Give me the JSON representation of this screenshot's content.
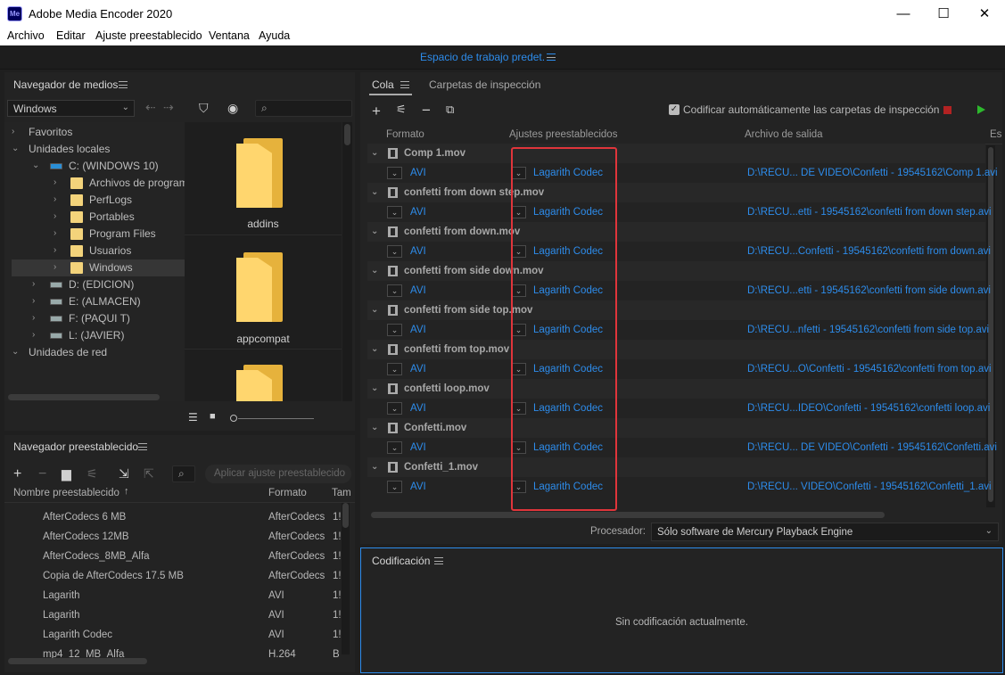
{
  "app": {
    "title": "Adobe Media Encoder 2020",
    "icon_text": "Me"
  },
  "window_controls": {
    "minimize": "—",
    "maximize": "☐",
    "close": "✕"
  },
  "menu": [
    "Archivo",
    "Editar",
    "Ajuste preestablecido",
    "Ventana",
    "Ayuda"
  ],
  "workspace": {
    "label": "Espacio de trabajo predet."
  },
  "media_browser": {
    "title": "Navegador de medios",
    "location": "Windows",
    "tree": [
      {
        "label": "Favoritos",
        "level": 0,
        "expanded": false,
        "kind": "section"
      },
      {
        "label": "Unidades locales",
        "level": 0,
        "expanded": true,
        "kind": "section"
      },
      {
        "label": "C: (WINDOWS 10)",
        "level": 1,
        "expanded": true,
        "kind": "drive"
      },
      {
        "label": "Archivos de programa",
        "level": 2,
        "expanded": false,
        "kind": "folder"
      },
      {
        "label": "PerfLogs",
        "level": 2,
        "expanded": false,
        "kind": "folder"
      },
      {
        "label": "Portables",
        "level": 2,
        "expanded": false,
        "kind": "folder"
      },
      {
        "label": "Program Files",
        "level": 2,
        "expanded": false,
        "kind": "folder"
      },
      {
        "label": "Usuarios",
        "level": 2,
        "expanded": false,
        "kind": "folder"
      },
      {
        "label": "Windows",
        "level": 2,
        "expanded": false,
        "kind": "folder",
        "selected": true
      },
      {
        "label": "D: (EDICION)",
        "level": 1,
        "expanded": false,
        "kind": "drive"
      },
      {
        "label": "E: (ALMACEN)",
        "level": 1,
        "expanded": false,
        "kind": "drive"
      },
      {
        "label": "F: (PAQUI T)",
        "level": 1,
        "expanded": false,
        "kind": "drive"
      },
      {
        "label": "L: (JAVIER)",
        "level": 1,
        "expanded": false,
        "kind": "drive"
      },
      {
        "label": "Unidades de red",
        "level": 0,
        "expanded": true,
        "kind": "section"
      }
    ],
    "thumbnails": [
      {
        "label": "addins"
      },
      {
        "label": "appcompat"
      },
      {
        "label": ""
      }
    ]
  },
  "preset_browser": {
    "title": "Navegador preestablecido",
    "apply_placeholder": "Aplicar ajuste preestablecido",
    "columns": [
      "Nombre preestablecido",
      "Formato",
      "Tam"
    ],
    "rows": [
      {
        "name": "AfterCodecs 6 MB",
        "format": "AfterCodecs",
        "size": "1!"
      },
      {
        "name": "AfterCodecs 12MB",
        "format": "AfterCodecs",
        "size": "1!"
      },
      {
        "name": "AfterCodecs_8MB_Alfa",
        "format": "AfterCodecs",
        "size": "1!"
      },
      {
        "name": "Copia de AfterCodecs 17.5 MB",
        "format": "AfterCodecs",
        "size": "1!"
      },
      {
        "name": "Lagarith",
        "format": "AVI",
        "size": "1!"
      },
      {
        "name": "Lagarith",
        "format": "AVI",
        "size": "1!"
      },
      {
        "name": "Lagarith Codec",
        "format": "AVI",
        "size": "1!"
      },
      {
        "name": "mp4_12_MB_Alfa",
        "format": "H.264",
        "size": "B"
      }
    ]
  },
  "queue": {
    "tabs": [
      "Cola",
      "Carpetas de inspección"
    ],
    "auto_encode_label": "Codificar automáticamente las carpetas de inspección",
    "columns": [
      "Formato",
      "Ajustes preestablecidos",
      "Archivo de salida",
      "Es"
    ],
    "items": [
      {
        "source": "Comp 1.mov",
        "format": "AVI",
        "preset": "Lagarith Codec",
        "output": "D:\\RECU... DE VIDEO\\Confetti - 19545162\\Comp 1.avi"
      },
      {
        "source": "confetti from down step.mov",
        "format": "AVI",
        "preset": "Lagarith Codec",
        "output": "D:\\RECU...etti - 19545162\\confetti from down step.avi"
      },
      {
        "source": "confetti from down.mov",
        "format": "AVI",
        "preset": "Lagarith Codec",
        "output": "D:\\RECU...Confetti - 19545162\\confetti from down.avi"
      },
      {
        "source": "confetti from side down.mov",
        "format": "AVI",
        "preset": "Lagarith Codec",
        "output": "D:\\RECU...etti - 19545162\\confetti from side down.avi"
      },
      {
        "source": "confetti from side top.mov",
        "format": "AVI",
        "preset": "Lagarith Codec",
        "output": "D:\\RECU...nfetti - 19545162\\confetti from side top.avi"
      },
      {
        "source": "confetti from top.mov",
        "format": "AVI",
        "preset": "Lagarith Codec",
        "output": "D:\\RECU...O\\Confetti - 19545162\\confetti from top.avi"
      },
      {
        "source": "confetti loop.mov",
        "format": "AVI",
        "preset": "Lagarith Codec",
        "output": "D:\\RECU...IDEO\\Confetti - 19545162\\confetti loop.avi"
      },
      {
        "source": "Confetti.mov",
        "format": "AVI",
        "preset": "Lagarith Codec",
        "output": "D:\\RECU... DE VIDEO\\Confetti - 19545162\\Confetti.avi"
      },
      {
        "source": "Confetti_1.mov",
        "format": "AVI",
        "preset": "Lagarith Codec",
        "output": "D:\\RECU... VIDEO\\Confetti - 19545162\\Confetti_1.avi"
      }
    ],
    "processor_label": "Procesador:",
    "processor_value": "Sólo software de Mercury Playback Engine"
  },
  "encoding": {
    "title": "Codificación",
    "status": "Sin codificación actualmente."
  },
  "colors": {
    "accent": "#2d8ceb",
    "highlight": "#e0353b",
    "start": "#2db82d",
    "stop": "#b22222"
  }
}
